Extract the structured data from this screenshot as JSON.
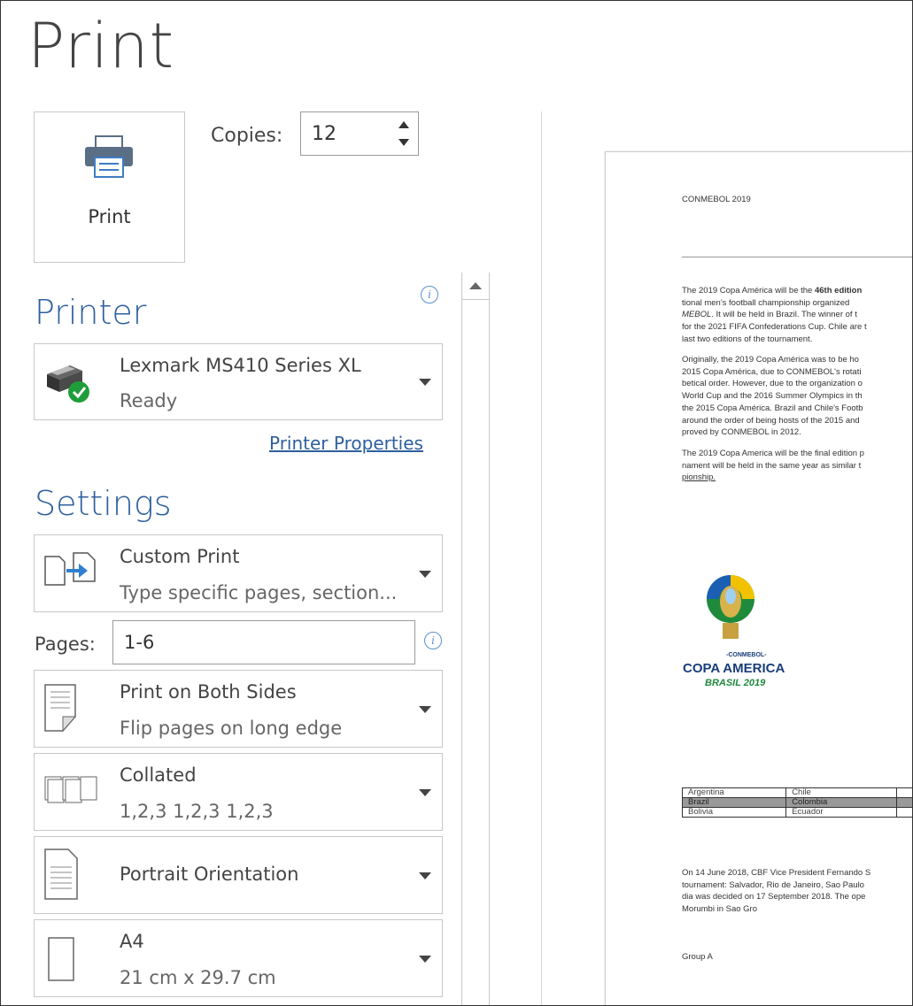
{
  "title": "Print",
  "print_button": {
    "label": "Print"
  },
  "copies": {
    "label": "Copies:",
    "value": "12"
  },
  "printer": {
    "heading": "Printer",
    "name": "Lexmark MS410 Series XL",
    "status": "Ready",
    "properties_link": "Printer Properties"
  },
  "settings": {
    "heading": "Settings",
    "range": {
      "title": "Custom Print",
      "subtitle": "Type specific pages, section..."
    },
    "pages": {
      "label": "Pages:",
      "value": "1-6"
    },
    "sides": {
      "title": "Print on Both Sides",
      "subtitle": "Flip pages on long edge"
    },
    "collate": {
      "title": "Collated",
      "subtitle": "1,2,3    1,2,3    1,2,3"
    },
    "orientation": {
      "title": "Portrait Orientation"
    },
    "paper": {
      "title": "A4",
      "subtitle": "21 cm x 29.7 cm"
    }
  },
  "preview": {
    "header": "CONMEBOL 2019",
    "para1": [
      "The 2019 Copa América will be the ",
      "46th edition",
      "tional men's football championship organized",
      "MEBOL",
      ". It will be held in Brazil. The winner of t",
      "for the 2021 FIFA Confederations Cup. Chile are t",
      "last two editions of the tournament."
    ],
    "para2": [
      "Originally, the 2019 Copa América was to be ho",
      "2015 Copa América, due to CONMEBOL's rotati",
      "betical order. However, due to the organization o",
      "World Cup and the 2016 Summer Olympics in th",
      "the 2015 Copa América. Brazil and Chile's Footb",
      "around the order of being hosts of the 2015 and",
      "proved by CONMEBOL in 2012."
    ],
    "para3": [
      "The 2019 Copa America will be the final edition p",
      "nament will be held in the same year as similar t",
      "pionship."
    ],
    "logo": {
      "small": "-CONMEBOL-",
      "main": "COPA AMERICA",
      "sub": "BRASIL 2019"
    },
    "table": [
      [
        "Argentina",
        "Chile"
      ],
      [
        "Brazil",
        "Colombia"
      ],
      [
        "Bolivia",
        "Ecuador"
      ]
    ],
    "para4": [
      "On 14 June 2018, CBF Vice President Fernando S",
      "tournament: Salvador, Rio de Janeiro, Sao Paulo",
      "dia was decided on 17 September 2018. The ope",
      "Morumbi in Sao Gro"
    ],
    "group": "Group A"
  },
  "colors": {
    "accent": "#2e5f9e",
    "printer_ok": "#1f9d3a"
  }
}
